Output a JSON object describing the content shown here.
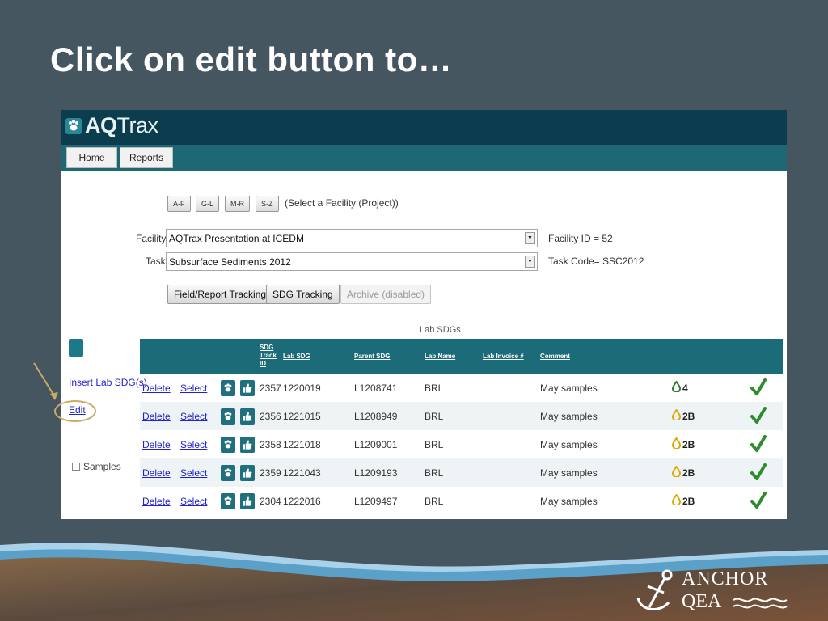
{
  "slide": {
    "title": "Click on edit button to…",
    "logo_line1": "ANCHOR",
    "logo_line2": "QEA"
  },
  "app": {
    "logo_text_a": "AQ",
    "logo_text_b": "Trax",
    "nav": {
      "home": "Home",
      "reports": "Reports"
    },
    "alpha_buttons": [
      "A-F",
      "G-L",
      "M-R",
      "S-Z"
    ],
    "select_facility_hint": "(Select a Facility (Project))",
    "facility_label": "Facility:",
    "facility_value": "AQTrax Presentation at ICEDM",
    "facility_id_label": "Facility ID =",
    "facility_id_value": "52",
    "task_label": "Task:",
    "task_value": "Subsurface Sediments 2012",
    "task_code_label": "Task Code=",
    "task_code_value": "SSC2012",
    "buttons": {
      "field_report": "Field/Report Tracking",
      "sdg_tracking": "SDG Tracking",
      "archive": "Archive (disabled)"
    },
    "lab_sdgs_title": "Lab SDGs",
    "sidebar": {
      "insert_link": "Insert Lab SDG(s)",
      "edit_link": "Edit",
      "samples_label": "Samples"
    },
    "table": {
      "headers": {
        "sdg_track_id_1": "SDG",
        "sdg_track_id_2": "Track",
        "sdg_track_id_3": "ID",
        "lab_sdg": "Lab SDG",
        "parent_sdg": "Parent SDG",
        "lab_name": "Lab Name",
        "lab_invoice": "Lab Invoice #",
        "comment": "Comment"
      },
      "rows": [
        {
          "delete": "Delete",
          "select": "Select",
          "track_id": "2357",
          "lab_sdg": "1220019",
          "parent_sdg": "L1208741",
          "lab_name": "BRL",
          "comment": "May samples",
          "status": "4",
          "status_color": "#2e7d32"
        },
        {
          "delete": "Delete",
          "select": "Select",
          "track_id": "2356",
          "lab_sdg": "1221015",
          "parent_sdg": "L1208949",
          "lab_name": "BRL",
          "comment": "May samples",
          "status": "2B",
          "status_color": "#e0a800"
        },
        {
          "delete": "Delete",
          "select": "Select",
          "track_id": "2358",
          "lab_sdg": "1221018",
          "parent_sdg": "L1209001",
          "lab_name": "BRL",
          "comment": "May samples",
          "status": "2B",
          "status_color": "#e0a800"
        },
        {
          "delete": "Delete",
          "select": "Select",
          "track_id": "2359",
          "lab_sdg": "1221043",
          "parent_sdg": "L1209193",
          "lab_name": "BRL",
          "comment": "May samples",
          "status": "2B",
          "status_color": "#e0a800"
        },
        {
          "delete": "Delete",
          "select": "Select",
          "track_id": "2304",
          "lab_sdg": "1222016",
          "parent_sdg": "L1209497",
          "lab_name": "BRL",
          "comment": "May samples",
          "status": "2B",
          "status_color": "#e0a800"
        }
      ]
    }
  }
}
